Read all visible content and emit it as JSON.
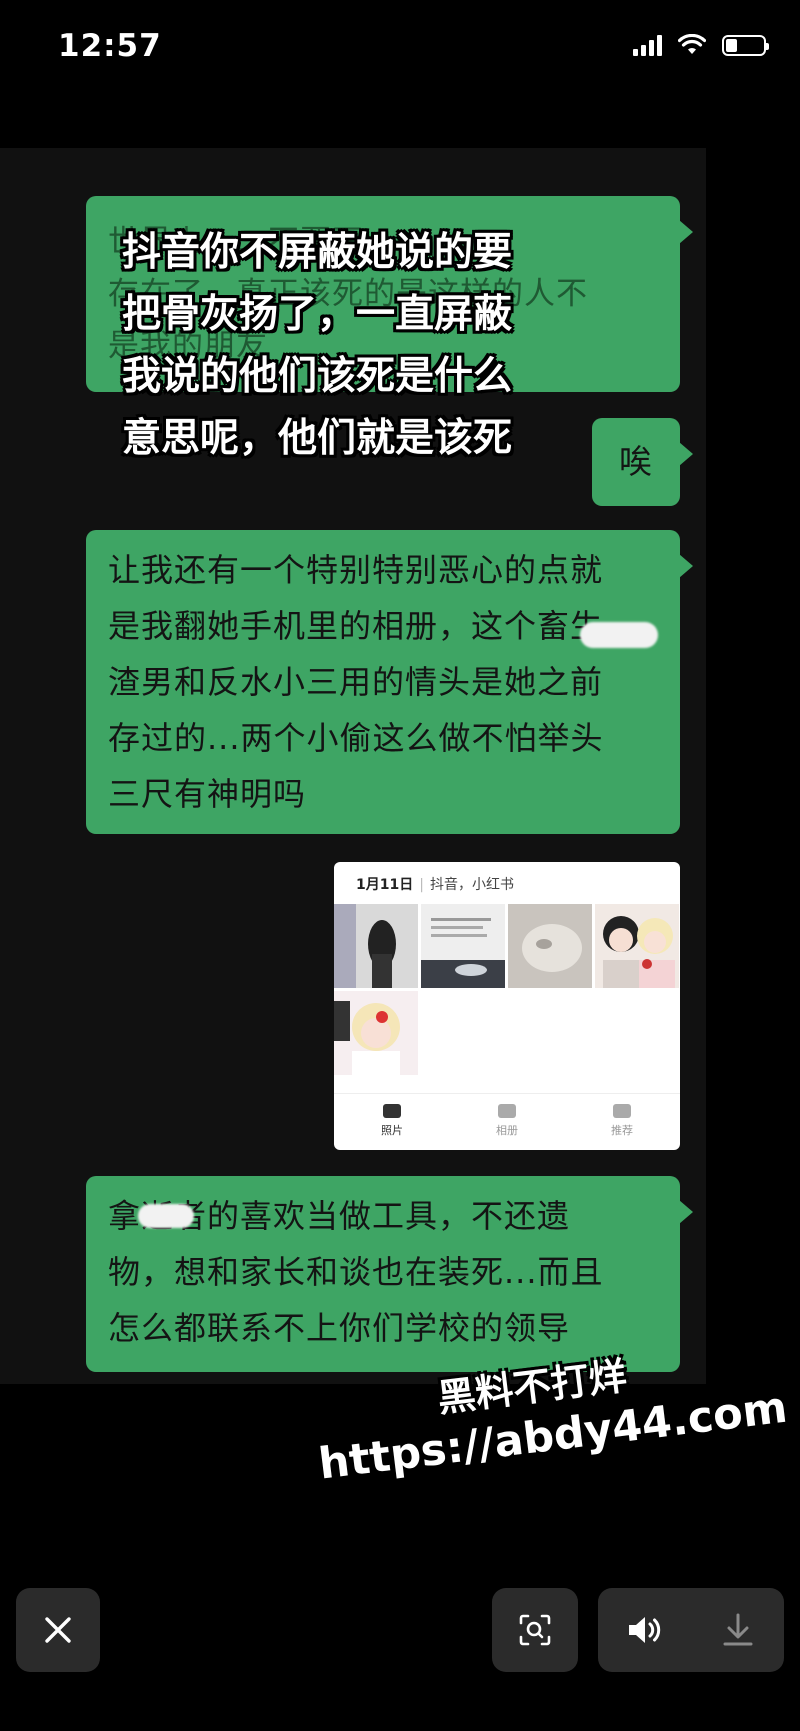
{
  "status_bar": {
    "time": "12:57",
    "battery_level": 0.3
  },
  "bubbles": {
    "b1": {
      "lines": "世界上……不要再\n存在了，真正该死的是这样的人不\n是我的朋友"
    },
    "b2": {
      "text": "唉"
    },
    "b3": {
      "lines": "让我还有一个特别特别恶心的点就\n是我翻她手机里的相册，这个畜生\n渣男和反水小三用的情头是她之前\n存过的...两个小偷这么做不怕举头\n三尺有神明吗"
    },
    "b4": {
      "lines": "拿逝者的喜欢当做工具，不还遗\n物，想和家长和谈也在装死...而且\n怎么都联系不上你们学校的领导"
    }
  },
  "overlay_caption": "抖音你不屏蔽她说的要\n把骨灰扬了，一直屏蔽\n我说的他们该死是什么\n意思呢，他们就是该死",
  "album": {
    "date": "1月11日",
    "sources": "抖音，小红书",
    "tabs": [
      {
        "label": "照片",
        "active": true
      },
      {
        "label": "相册",
        "active": false
      },
      {
        "label": "推荐",
        "active": false
      }
    ]
  },
  "watermark": {
    "line1": "黑料不打烊",
    "line2": "https://abdy44.com"
  },
  "controls": {
    "close_icon": "close-icon",
    "scan_icon": "scan-icon",
    "volume_icon": "volume-icon",
    "download_icon": "download-icon"
  },
  "colors": {
    "bubble": "#3ea564",
    "background": "#000000"
  }
}
